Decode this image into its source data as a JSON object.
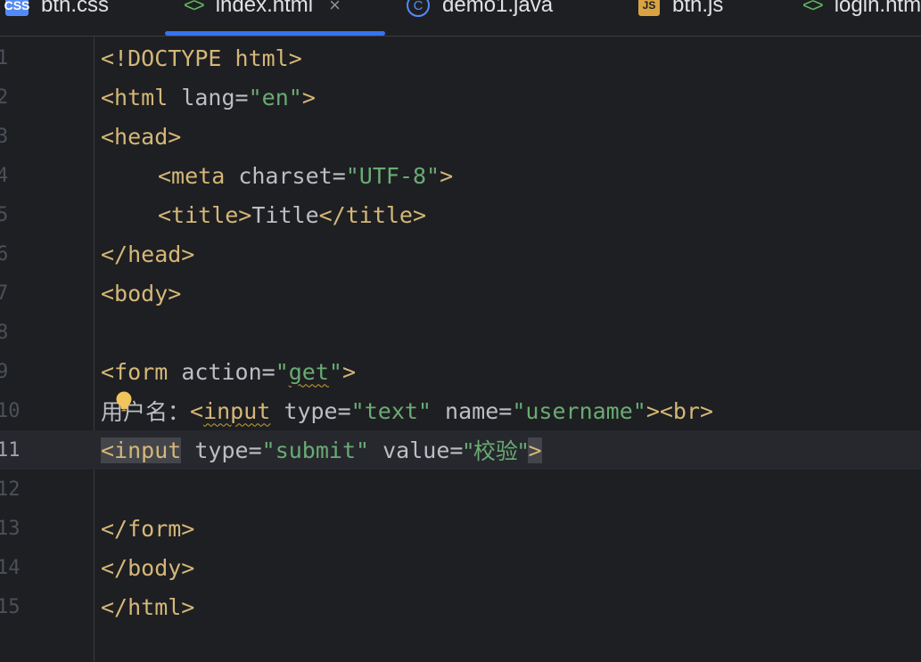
{
  "tabs": [
    {
      "label": "btn.css",
      "icon": "css-file-icon",
      "active": false
    },
    {
      "label": "index.html",
      "icon": "html-file-icon",
      "active": true
    },
    {
      "label": "demo1.java",
      "icon": "java-class-icon",
      "active": false
    },
    {
      "label": "btn.js",
      "icon": "js-file-icon",
      "active": false
    },
    {
      "label": "login.html",
      "icon": "html-file-icon",
      "active": false
    }
  ],
  "tab_icon_text": {
    "css": "CSS",
    "html": "<>",
    "java": "C",
    "js": "JS"
  },
  "close_glyph": "×",
  "lines": [
    {
      "num": "1"
    },
    {
      "num": "2"
    },
    {
      "num": "3"
    },
    {
      "num": "4"
    },
    {
      "num": "5"
    },
    {
      "num": "6"
    },
    {
      "num": "7"
    },
    {
      "num": "8"
    },
    {
      "num": "9"
    },
    {
      "num": "10"
    },
    {
      "num": "11"
    },
    {
      "num": "12"
    },
    {
      "num": "13"
    },
    {
      "num": "14"
    },
    {
      "num": "15"
    }
  ],
  "code": {
    "l1": "<!DOCTYPE html>",
    "l2_tag": "<html",
    "l2_attr": " lang",
    "l2_eq": "=",
    "l2_val": "\"en\"",
    "l2_end": ">",
    "l3": "<head>",
    "l4_tag": "<meta",
    "l4_attr": " charset",
    "l4_eq": "=",
    "l4_val": "\"UTF-8\"",
    "l4_end": ">",
    "l5_open": "<title>",
    "l5_text": "Title",
    "l5_close": "</title>",
    "l6": "</head>",
    "l7": "<body>",
    "l9_tag": "<form",
    "l9_attr": " action",
    "l9_eq": "=",
    "l9_q1": "\"",
    "l9_val": "get",
    "l9_q2": "\"",
    "l9_end": ">",
    "l10_text": "用户名：",
    "l10_lt": "<",
    "l10_tag": "input",
    "l10_attr1": " type",
    "l10_eq1": "=",
    "l10_val1": "\"text\"",
    "l10_attr2": " name",
    "l10_eq2": "=",
    "l10_val2": "\"username\"",
    "l10_end": "><br>",
    "l11_tag": "<input",
    "l11_attr1": " type",
    "l11_eq1": "=",
    "l11_val1": "\"submit\"",
    "l11_attr2": " value",
    "l11_eq2": "=",
    "l11_val2": "\"校验\"",
    "l11_end": ">",
    "l13": "</form>",
    "l14": "</body>",
    "l15": "</html>"
  },
  "current_line": "11",
  "colors": {
    "tag": "#d5b778",
    "attr": "#bcbec4",
    "string": "#6aab73",
    "accent": "#3574f0",
    "bulb": "#f2c55c"
  }
}
